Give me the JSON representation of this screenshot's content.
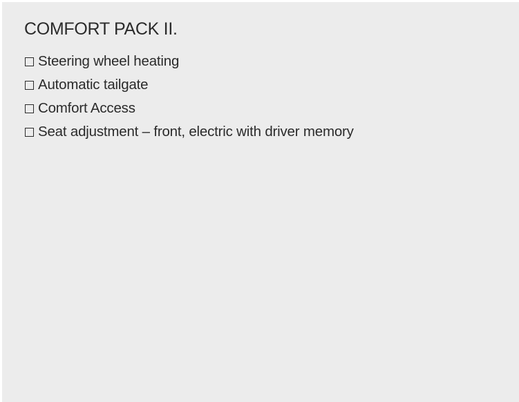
{
  "panel": {
    "title": "COMFORT PACK II.",
    "items": [
      {
        "label": "Steering wheel heating",
        "checked": false
      },
      {
        "label": "Automatic tailgate",
        "checked": false
      },
      {
        "label": "Comfort Access",
        "checked": false
      },
      {
        "label": "Seat adjustment – front, electric with driver memory",
        "checked": false
      }
    ]
  }
}
